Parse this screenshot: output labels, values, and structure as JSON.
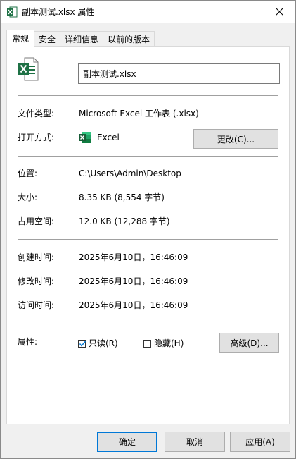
{
  "window": {
    "title": "副本测试.xlsx 属性"
  },
  "tabs": [
    {
      "label": "常规"
    },
    {
      "label": "安全"
    },
    {
      "label": "详细信息"
    },
    {
      "label": "以前的版本"
    }
  ],
  "general": {
    "file_name": "副本测试.xlsx",
    "file_type_label": "文件类型:",
    "file_type_value": "Microsoft Excel 工作表 (.xlsx)",
    "open_with_label": "打开方式:",
    "open_with_value": "Excel",
    "change_button": "更改(C)...",
    "location_label": "位置:",
    "location_value": "C:\\Users\\Admin\\Desktop",
    "size_label": "大小:",
    "size_value": "8.35 KB (8,554 字节)",
    "size_on_disk_label": "占用空间:",
    "size_on_disk_value": "12.0 KB (12,288 字节)",
    "created_label": "创建时间:",
    "created_value": "2025年6月10日，16:46:09",
    "modified_label": "修改时间:",
    "modified_value": "2025年6月10日，16:46:09",
    "accessed_label": "访问时间:",
    "accessed_value": "2025年6月10日，16:46:09",
    "attributes_label": "属性:",
    "readonly_label": "只读(R)",
    "readonly_checked": true,
    "hidden_label": "隐藏(H)",
    "hidden_checked": false,
    "advanced_button": "高级(D)..."
  },
  "footer": {
    "ok_button": "确定",
    "cancel_button": "取消",
    "apply_button": "应用(A)"
  },
  "colors": {
    "excel_green": "#1e7145",
    "accent_blue": "#0078d7"
  },
  "icons": [
    "excel-title-icon",
    "close-icon",
    "excel-file-icon",
    "excel-app-icon",
    "checkmark-icon"
  ]
}
